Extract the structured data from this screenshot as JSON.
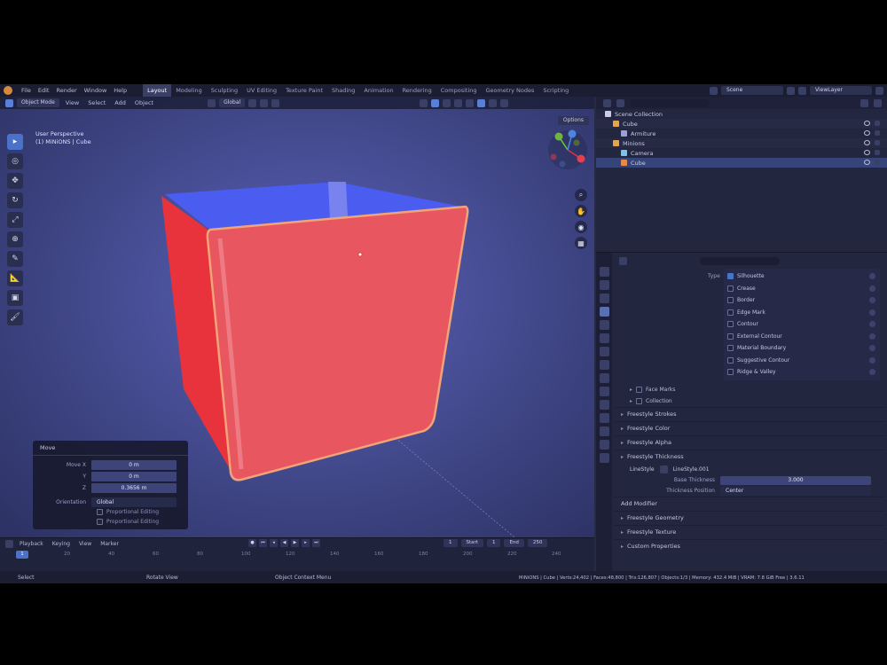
{
  "topbar": {
    "menus": [
      "File",
      "Edit",
      "Render",
      "Window",
      "Help"
    ],
    "workspaces": [
      "Layout",
      "Modeling",
      "Sculpting",
      "UV Editing",
      "Texture Paint",
      "Shading",
      "Animation",
      "Rendering",
      "Compositing",
      "Geometry Nodes",
      "Scripting"
    ],
    "active_workspace": "Layout",
    "scene": "Scene",
    "view_layer": "ViewLayer"
  },
  "viewport": {
    "mode": "Object Mode",
    "menus": [
      "View",
      "Select",
      "Add",
      "Object"
    ],
    "transform": "Global",
    "options": "Options",
    "info_line1": "User Perspective",
    "info_line2": "(1) MiNiONS | Cube"
  },
  "operator_panel": {
    "title": "Move",
    "rows": [
      {
        "label": "Move X",
        "value": "0 m"
      },
      {
        "label": "Y",
        "value": "0 m"
      },
      {
        "label": "Z",
        "value": "0.3656 m"
      }
    ],
    "orientation_label": "Orientation",
    "orientation_value": "Global",
    "checks": [
      "Proportional Editing",
      "Proportional Editing"
    ]
  },
  "timeline": {
    "menus": [
      "Playback",
      "Keying",
      "View",
      "Marker"
    ],
    "current_frame": "1",
    "start_label": "Start",
    "start_value": "1",
    "end_label": "End",
    "end_value": "250",
    "frame_field": "1",
    "ticks": [
      "0",
      "20",
      "40",
      "60",
      "80",
      "100",
      "120",
      "140",
      "160",
      "180",
      "200",
      "220",
      "240"
    ]
  },
  "statusbar": {
    "select": "Select",
    "rotate": "Rotate View",
    "context": "Object Context Menu",
    "stats": "MiNiONS | Cube | Verts:24,402 | Faces:48,800 | Tris:126,807 | Objects:1/3 | Memory: 432.4 MiB | VRAM: 7.8 GiB Free | 3.6.11"
  },
  "outliner": {
    "rows": [
      {
        "label": "Scene Collection",
        "indent": 0
      },
      {
        "label": "Cube",
        "indent": 1
      },
      {
        "label": "Armiture",
        "indent": 2
      },
      {
        "label": "Minions",
        "indent": 1
      },
      {
        "label": "Camera",
        "indent": 2
      },
      {
        "label": "Cube",
        "indent": 2
      }
    ]
  },
  "properties": {
    "type_label": "Type",
    "types": [
      "Silhouette",
      "Crease",
      "Border",
      "Edge Mark",
      "Contour",
      "External Contour",
      "Material Boundary",
      "Suggestive Contour",
      "Ridge & Valley"
    ],
    "sub_checks": [
      "Face Marks",
      "Collection"
    ],
    "sections": [
      "Freestyle Strokes",
      "Freestyle Color",
      "Freestyle Alpha",
      "Freestyle Thickness"
    ],
    "lineset": "LineStyle",
    "lineset_name": "LineStyle.001",
    "base_thickness_label": "Base Thickness",
    "base_thickness_value": "3.000",
    "thickness_position_label": "Thickness Position",
    "thickness_position_value": "Center",
    "add_modifier": "Add Modifier",
    "bottom_sections": [
      "Freestyle Geometry",
      "Freestyle Texture",
      "Custom Properties"
    ]
  }
}
